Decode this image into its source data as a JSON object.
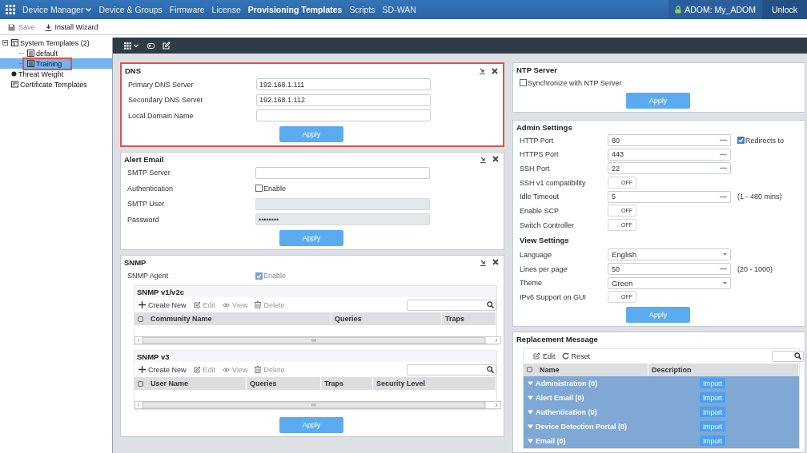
{
  "top_nav": {
    "items": [
      {
        "label": "Device Manager",
        "dropdown": true,
        "selected": false
      },
      {
        "label": "Device & Groups",
        "dropdown": false,
        "selected": false
      },
      {
        "label": "Firmware",
        "dropdown": false,
        "selected": false
      },
      {
        "label": "License",
        "dropdown": false,
        "selected": false
      },
      {
        "label": "Provisioning Templates",
        "dropdown": false,
        "selected": true
      },
      {
        "label": "Scripts",
        "dropdown": false,
        "selected": false
      },
      {
        "label": "SD-WAN",
        "dropdown": false,
        "selected": false
      }
    ],
    "adom": "ADOM: My_ADOM",
    "unlock": "Unlock"
  },
  "actions": [
    {
      "label": "Save",
      "disabled": true
    },
    {
      "label": "Install Wizard",
      "disabled": false
    }
  ],
  "tree": [
    {
      "kind": "folder",
      "label": "System Templates (2)",
      "expanded": true,
      "selected": false,
      "highlighted": false,
      "children": [
        {
          "kind": "template",
          "label": "default",
          "selected": false,
          "highlighted": false
        },
        {
          "kind": "template",
          "label": "Training",
          "selected": true,
          "highlighted": true
        }
      ]
    },
    {
      "kind": "dot",
      "label": "Threat Weight",
      "selected": false,
      "highlighted": false
    },
    {
      "kind": "certificate",
      "label": "Certificate Templates",
      "selected": false,
      "highlighted": false
    }
  ],
  "columns": [
    {
      "panels": [
        {
          "title": "DNS",
          "highlighted": true,
          "rows": [
            {
              "kind": "text",
              "label": "Primary DNS Server",
              "value": "192.168.1.111",
              "disabled": false
            },
            {
              "kind": "text",
              "label": "Secondary DNS Server",
              "value": "192.168.1.112",
              "disabled": false
            },
            {
              "kind": "text",
              "label": "Local Domain Name",
              "disabled": false
            }
          ],
          "apply": "Apply"
        },
        {
          "title": "Alert Email",
          "highlighted": false,
          "rows": [
            {
              "kind": "text",
              "label": "SMTP Server",
              "disabled": false
            },
            {
              "kind": "checkbox",
              "label": "Authentication",
              "text": "Enable",
              "checked": false,
              "disabled": false
            },
            {
              "kind": "text",
              "label": "SMTP User",
              "disabled": true
            },
            {
              "kind": "text",
              "label": "Password",
              "value": "••••••••",
              "disabled": true
            }
          ],
          "apply": "Apply"
        },
        {
          "title": "SNMP",
          "highlighted": false,
          "rows": [
            {
              "kind": "checkbox",
              "label": "SNMP Agent",
              "text": "Enable",
              "checked": true,
              "disabled": true
            }
          ],
          "tables": [
            {
              "title": "SNMP v1/v2c",
              "select_all_checked": false,
              "actions": [
                {
                  "kind": "create",
                  "label": "Create New",
                  "disabled": false
                },
                {
                  "kind": "edit",
                  "label": "Edit",
                  "disabled": true
                },
                {
                  "kind": "view",
                  "label": "View",
                  "disabled": true
                },
                {
                  "kind": "delete",
                  "label": "Delete",
                  "disabled": true
                }
              ],
              "columns": [
                "Community Name",
                "Queries",
                "Traps"
              ]
            },
            {
              "title": "SNMP v3",
              "select_all_checked": false,
              "actions": [
                {
                  "kind": "create",
                  "label": "Create New",
                  "disabled": false
                },
                {
                  "kind": "edit",
                  "label": "Edit",
                  "disabled": true
                },
                {
                  "kind": "view",
                  "label": "View",
                  "disabled": true
                },
                {
                  "kind": "delete",
                  "label": "Delete",
                  "disabled": true
                }
              ],
              "columns": [
                "User Name",
                "Queries",
                "Traps",
                "Security Level"
              ]
            }
          ],
          "apply": "Apply"
        }
      ]
    },
    {
      "panels": [
        {
          "title": "NTP Server",
          "highlighted": false,
          "rows": [
            {
              "kind": "checkbox",
              "text": "Synchronize with NTP Server",
              "checked": false,
              "disabled": false
            }
          ],
          "apply": "Apply"
        },
        {
          "title": "Admin Settings",
          "highlighted": false,
          "rows": [
            {
              "kind": "number",
              "label": "HTTP Port",
              "value": "80",
              "extra": {
                "text": "Redirects to",
                "checked": true
              }
            },
            {
              "kind": "number",
              "label": "HTTPS Port",
              "value": "443"
            },
            {
              "kind": "number",
              "label": "SSH Port",
              "value": "22"
            },
            {
              "kind": "toggle",
              "label": "SSH v1 compatibility",
              "text": "OFF",
              "on": false
            },
            {
              "kind": "number",
              "label": "Idle Timeout",
              "value": "5",
              "hint": "(1 - 480 mins)"
            },
            {
              "kind": "toggle",
              "label": "Enable SCP",
              "text": "OFF",
              "on": false
            },
            {
              "kind": "toggle",
              "label": "Switch Controller",
              "text": "OFF",
              "on": false
            },
            {
              "kind": "heading",
              "label": "View Settings"
            },
            {
              "kind": "select",
              "label": "Language",
              "value": "English"
            },
            {
              "kind": "number",
              "label": "Lines per page",
              "value": "50",
              "hint": "(20 - 1000)"
            },
            {
              "kind": "select",
              "label": "Theme",
              "value": "Green"
            },
            {
              "kind": "toggle",
              "label": "IPv6 Support on GUI",
              "text": "OFF",
              "on": false
            }
          ],
          "apply": "Apply"
        },
        {
          "title": "Replacement Message",
          "highlighted": false,
          "messages": {
            "actions": [
              {
                "kind": "edit",
                "label": "Edit",
                "disabled": false
              },
              {
                "kind": "reset",
                "label": "Reset",
                "disabled": false
              }
            ],
            "columns": [
              "Name",
              "Description"
            ],
            "select_all_checked": false,
            "groups": [
              {
                "label": "Administration (0)",
                "expanded": true,
                "button": "Import"
              },
              {
                "label": "Alert Email (0)",
                "expanded": true,
                "button": "Import"
              },
              {
                "label": "Authentication (0)",
                "expanded": true,
                "button": "Import"
              },
              {
                "label": "Device Detection Portal (0)",
                "expanded": true,
                "button": "Import"
              },
              {
                "label": "Email (0)",
                "expanded": true,
                "button": "Import"
              }
            ]
          }
        }
      ]
    }
  ]
}
